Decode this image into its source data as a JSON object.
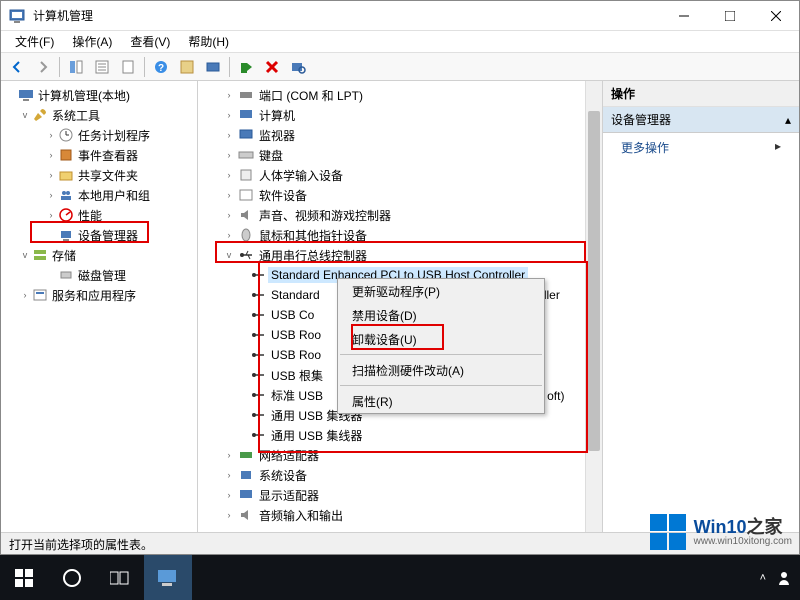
{
  "window": {
    "title": "计算机管理"
  },
  "menubar": {
    "file": "文件(F)",
    "action": "操作(A)",
    "view": "查看(V)",
    "help": "帮助(H)"
  },
  "left_tree": {
    "root": "计算机管理(本地)",
    "system_tools": "系统工具",
    "task_scheduler": "任务计划程序",
    "event_viewer": "事件查看器",
    "shared_folders": "共享文件夹",
    "local_users": "本地用户和组",
    "performance": "性能",
    "device_manager": "设备管理器",
    "storage": "存储",
    "disk_management": "磁盘管理",
    "services_apps": "服务和应用程序"
  },
  "devices": {
    "com_lpt": "端口 (COM 和 LPT)",
    "computer": "计算机",
    "monitor": "监视器",
    "keyboard": "键盘",
    "hid": "人体学输入设备",
    "software": "软件设备",
    "sound": "声音、视频和游戏控制器",
    "mouse": "鼠标和其他指针设备",
    "usb_controllers": "通用串行总线控制器",
    "usb_item1": "Standard Enhanced PCI to USB Host Controller",
    "usb_item2_prefix": "Standard",
    "usb_item2_suffix": "ller",
    "usb_item3_prefix": "USB Co",
    "usb_item4_prefix": "USB Roo",
    "usb_item5_prefix": "USB Roo",
    "usb_item6": "USB 根集",
    "usb_item7_prefix": "标准 USB",
    "usb_item7_suffix": "oft)",
    "usb_item8": "通用 USB 集线器",
    "usb_item9": "通用 USB 集线器",
    "network": "网络适配器",
    "sys_devices": "系统设备",
    "display": "显示适配器",
    "audio_io": "音频输入和输出"
  },
  "context_menu": {
    "update_driver": "更新驱动程序(P)",
    "disable": "禁用设备(D)",
    "uninstall": "卸载设备(U)",
    "scan_hw": "扫描检测硬件改动(A)",
    "properties": "属性(R)"
  },
  "right_pane": {
    "header": "操作",
    "subheader": "设备管理器",
    "more": "更多操作"
  },
  "statusbar": {
    "text": "打开当前选择项的属性表。"
  },
  "watermark": {
    "brand_prefix": "Win10",
    "brand_suffix": "之家",
    "url": "www.win10xitong.com"
  }
}
